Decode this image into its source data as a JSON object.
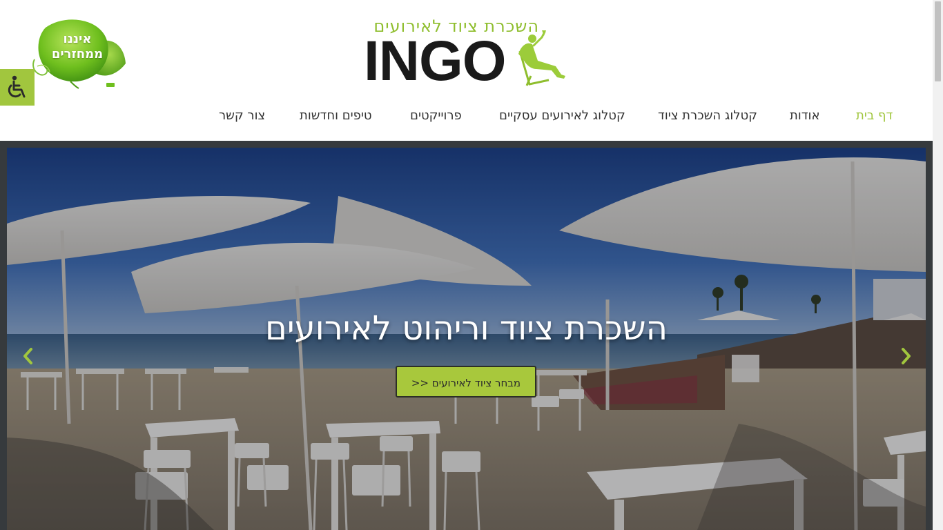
{
  "badge": {
    "line1": "איננו",
    "line2": "ממחזרים"
  },
  "accessibility": {
    "icon": "wheelchair-icon",
    "color": "#a1c63e"
  },
  "logo": {
    "tagline": "השכרת ציוד לאירועים",
    "wordmark": "INGO",
    "accent": "#8fbe2e"
  },
  "nav": {
    "items": [
      {
        "label": "דף בית",
        "active": true
      },
      {
        "label": "אודות"
      },
      {
        "label": "קטלוג השכרת ציוד"
      },
      {
        "label": "קטלוג לאירועים עסקיים"
      },
      {
        "label": "פרוייקטים"
      },
      {
        "label": "טיפים וחדשות"
      },
      {
        "label": "צור קשר"
      }
    ],
    "active_color": "#a1c63e",
    "text_color": "#333333"
  },
  "hero": {
    "title": "השכרת ציוד וריהוט לאירועים",
    "cta": "מבחר ציוד לאירועים <<",
    "prev_icon": "chevron-left-icon",
    "next_icon": "chevron-right-icon",
    "frame_color": "#363a3d"
  }
}
